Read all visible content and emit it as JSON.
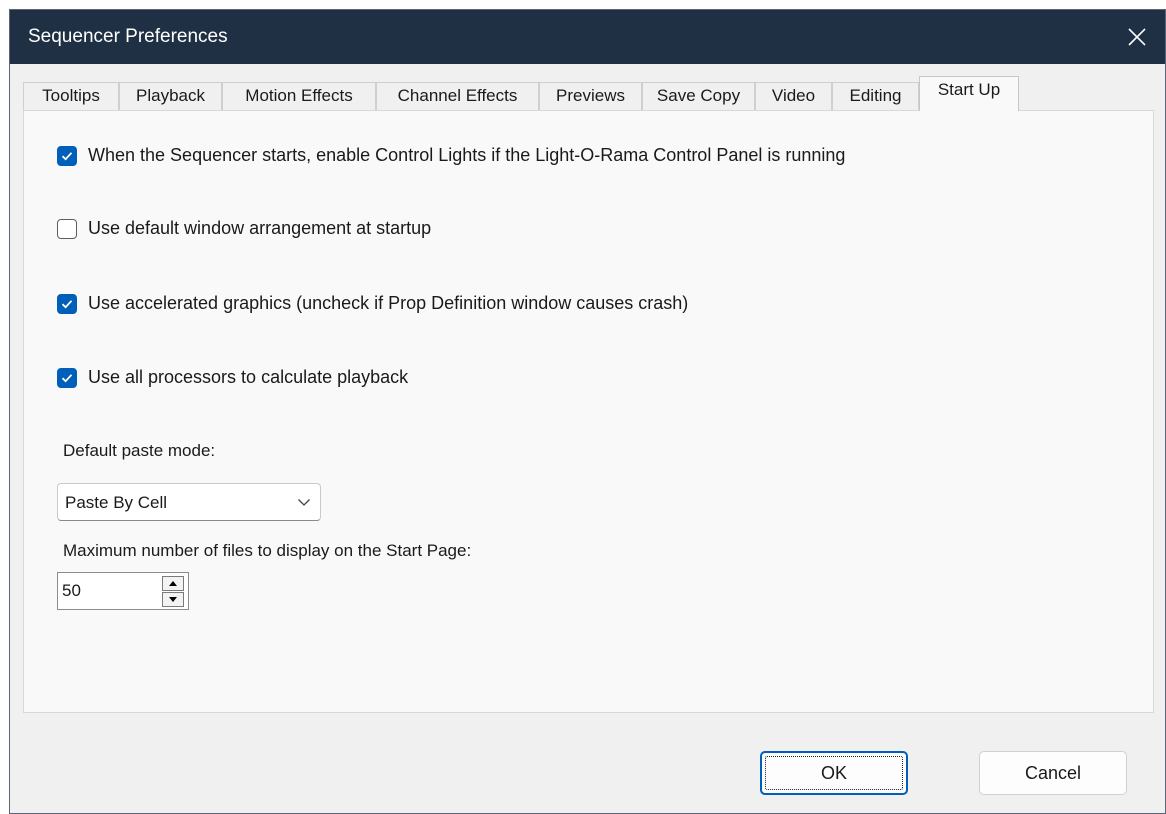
{
  "window": {
    "title": "Sequencer Preferences"
  },
  "tabs": [
    {
      "label": "Tooltips"
    },
    {
      "label": "Playback"
    },
    {
      "label": "Motion Effects"
    },
    {
      "label": "Channel Effects"
    },
    {
      "label": "Previews"
    },
    {
      "label": "Save Copy"
    },
    {
      "label": "Video"
    },
    {
      "label": "Editing"
    },
    {
      "label": "Start Up",
      "active": true
    }
  ],
  "options": [
    {
      "label": "When the Sequencer starts, enable Control Lights if the Light-O-Rama Control Panel is running",
      "checked": true
    },
    {
      "label": "Use default window arrangement at startup",
      "checked": false
    },
    {
      "label": "Use accelerated graphics (uncheck if Prop Definition window causes crash)",
      "checked": true
    },
    {
      "label": "Use all processors to calculate playback",
      "checked": true
    }
  ],
  "paste_mode": {
    "label": "Default paste mode:",
    "value": "Paste By Cell"
  },
  "max_files": {
    "label": "Maximum number of files to display on the Start Page:",
    "value": "50"
  },
  "buttons": {
    "ok": "OK",
    "cancel": "Cancel"
  },
  "colors": {
    "titlebar": "#1f3045",
    "accent": "#005fb8",
    "panel": "#f9f9f9"
  },
  "icons": {
    "close": "close-icon",
    "dropdown": "chevron-down-icon",
    "spin_up": "arrow-up-icon",
    "spin_down": "arrow-down-icon",
    "check": "checkmark-icon"
  }
}
